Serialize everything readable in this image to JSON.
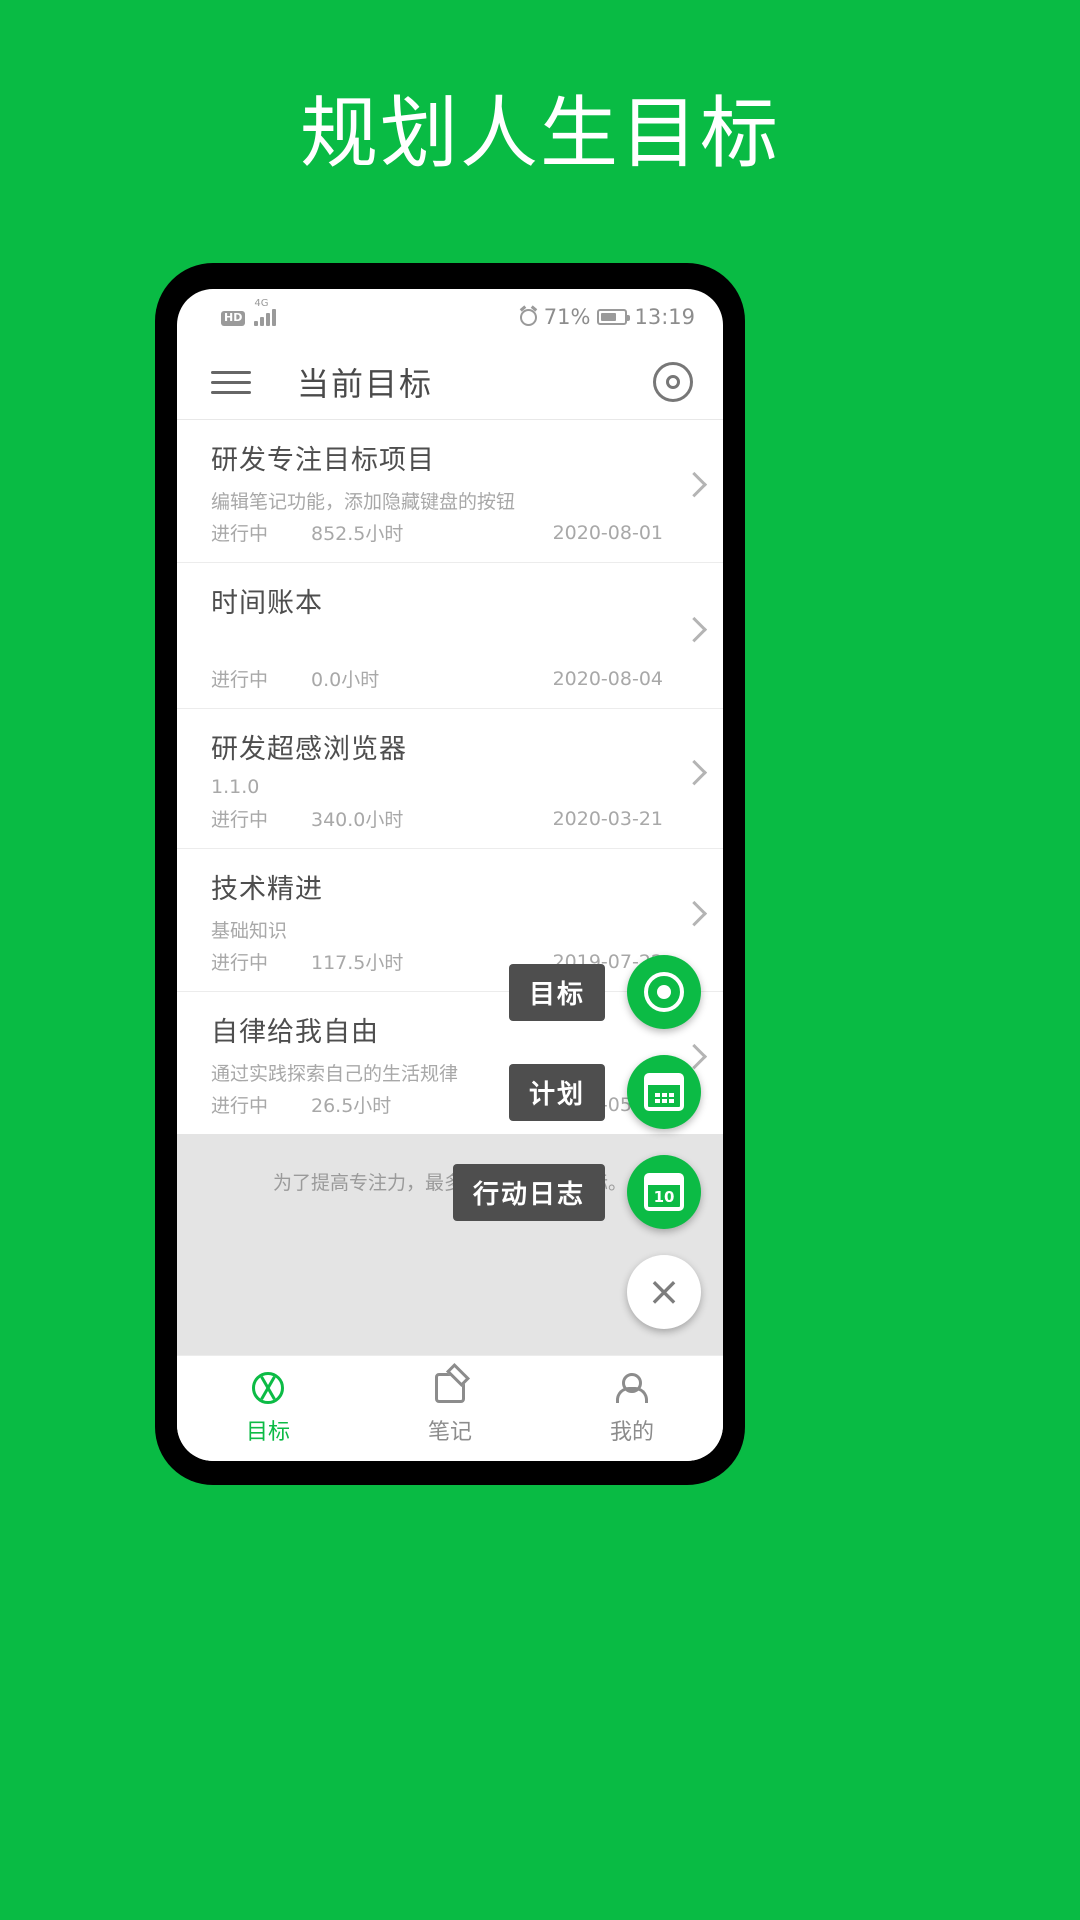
{
  "promo": {
    "title": "规划人生目标",
    "background_color": "#09bb44"
  },
  "statusbar": {
    "hd_label": "HD",
    "network_label": "4G",
    "battery_percent": "71%",
    "time": "13:19",
    "alarm_icon": "alarm-icon",
    "signal_icon": "signal-bars-icon",
    "battery_icon": "battery-icon"
  },
  "appbar": {
    "menu_icon": "hamburger-menu-icon",
    "title": "当前目标",
    "action_icon": "target-ring-icon"
  },
  "goals": [
    {
      "title": "研发专注目标项目",
      "subtitle": "编辑笔记功能，添加隐藏键盘的按钮",
      "state": "进行中",
      "hours": "852.5小时",
      "date": "2020-08-01"
    },
    {
      "title": "时间账本",
      "subtitle": "",
      "state": "进行中",
      "hours": "0.0小时",
      "date": "2020-08-04"
    },
    {
      "title": "研发超感浏览器",
      "subtitle": "1.1.0",
      "state": "进行中",
      "hours": "340.0小时",
      "date": "2020-03-21"
    },
    {
      "title": "技术精进",
      "subtitle": "基础知识",
      "state": "进行中",
      "hours": "117.5小时",
      "date": "2019-07-22"
    },
    {
      "title": "自律给我自由",
      "subtitle": "通过实践探索自己的生活规律",
      "state": "进行中",
      "hours": "26.5小时",
      "date": "2019-05-01"
    }
  ],
  "sheet": {
    "hint": "为了提高专注力，最多显示5个当前目标。",
    "accent_color": "#0cbb45",
    "actions": [
      {
        "label": "目标",
        "icon": "target-ring-icon"
      },
      {
        "label": "计划",
        "icon": "calendar-grid-icon"
      },
      {
        "label": "行动日志",
        "icon": "calendar-day-icon",
        "day": "10"
      }
    ],
    "close_label": "×"
  },
  "bottomnav": {
    "items": [
      {
        "label": "目标",
        "icon": "aperture-icon",
        "active": true
      },
      {
        "label": "笔记",
        "icon": "note-edit-icon",
        "active": false
      },
      {
        "label": "我的",
        "icon": "person-icon",
        "active": false
      }
    ]
  }
}
